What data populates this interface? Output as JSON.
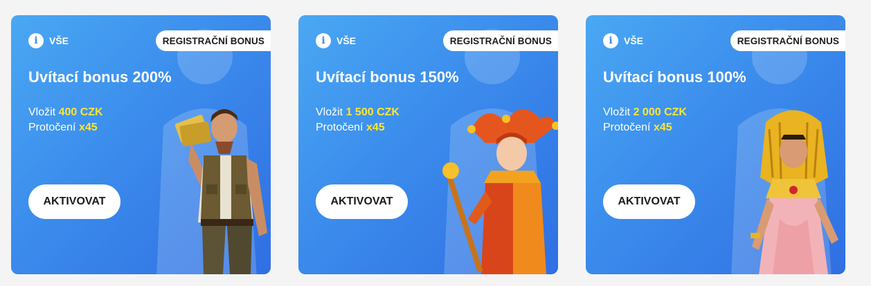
{
  "cards": [
    {
      "filter_label": "VŠE",
      "badge": "REGISTRAČNÍ BONUS",
      "title": "Uvítací bonus 200%",
      "deposit_prefix": "Vložit",
      "deposit_amount": "400 CZK",
      "spins_prefix": "Protočení",
      "spins_value": "x45",
      "button_label": "AKTIVOVAT",
      "character_icon": "explorer-character"
    },
    {
      "filter_label": "VŠE",
      "badge": "REGISTRAČNÍ BONUS",
      "title": "Uvítací bonus 150%",
      "deposit_prefix": "Vložit",
      "deposit_amount": "1 500 CZK",
      "spins_prefix": "Protočení",
      "spins_value": "x45",
      "button_label": "AKTIVOVAT",
      "character_icon": "jester-character"
    },
    {
      "filter_label": "VŠE",
      "badge": "REGISTRAČNÍ BONUS",
      "title": "Uvítací bonus 100%",
      "deposit_prefix": "Vložit",
      "deposit_amount": "2 000 CZK",
      "spins_prefix": "Protočení",
      "spins_value": "x45",
      "button_label": "AKTIVOVAT",
      "character_icon": "cleopatra-character"
    }
  ],
  "colors": {
    "card_gradient_start": "#4aa8f3",
    "card_gradient_end": "#2f6fe3",
    "highlight": "#ffe535",
    "button_bg": "#ffffff"
  }
}
